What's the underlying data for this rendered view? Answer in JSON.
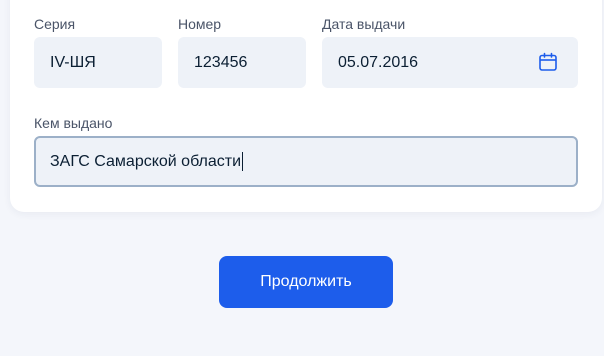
{
  "form": {
    "series": {
      "label": "Серия",
      "value": "IV-ШЯ"
    },
    "number": {
      "label": "Номер",
      "value": "123456"
    },
    "issue_date": {
      "label": "Дата выдачи",
      "value": "05.07.2016"
    },
    "issued_by": {
      "label": "Кем выдано",
      "value": "ЗАГС Самарской области"
    }
  },
  "actions": {
    "continue_label": "Продолжить"
  },
  "colors": {
    "primary": "#1d5deb",
    "field_bg": "#eef2f8",
    "page_bg": "#f4f6fb"
  },
  "icons": {
    "date_picker": "calendar-icon"
  }
}
